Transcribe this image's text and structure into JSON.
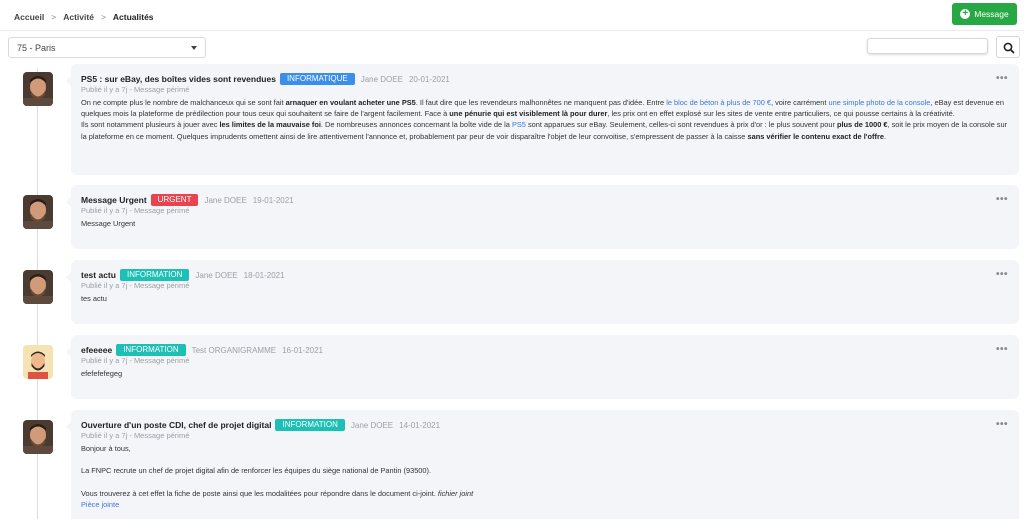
{
  "breadcrumb": {
    "home": "Accueil",
    "section": "Activité",
    "current": "Actualités",
    "separator": ">"
  },
  "toolbar": {
    "message_label": "Message"
  },
  "filter": {
    "location": "75 - Paris"
  },
  "common": {
    "published": "Publié il y a 7j - Message périmé",
    "more": "•••"
  },
  "colors": {
    "informatique": "#3b8fe8",
    "urgent": "#e8434f",
    "information": "#1dc0b5",
    "success": "#28a745"
  },
  "posts": [
    {
      "title": "PS5 : sur eBay, des boîtes vides sont revendues",
      "badge": "INFORMATIQUE",
      "author": "Jane DOEE",
      "date": "20-01-2021",
      "p1": {
        "t1": "On ne compte plus le nombre de malchanceux qui se sont fait ",
        "b1": "arnaquer en voulant acheter une PS5",
        "t2": ". Il faut dire que les revendeurs malhonnêtes ne manquent pas d'idée. Entre ",
        "l1": "le bloc de béton à plus de 700 €",
        "t3": ", voire carrément ",
        "l2": "une simple photo de la console",
        "t4": ", eBay est devenue en quelques mois la plateforme de prédilection pour tous ceux qui souhaitent se faire de l'argent facilement. Face à ",
        "b2": "une pénurie qui est visiblement là pour durer",
        "t5": ", les prix ont en effet explosé sur les sites de vente entre particuliers, ce qui pousse certains à la créativité."
      },
      "p2": {
        "t1": "Ils sont notamment plusieurs à jouer avec ",
        "b1": "les limites de la mauvaise foi",
        "t2": ". De nombreuses annonces concernant la boîte vide de la ",
        "l1": "PS5",
        "t3": " sont apparues sur eBay. Seulement, celles-ci sont revendues à prix d'or : le plus souvent pour ",
        "b2": "plus de 1000 €",
        "t4": ", soit le prix moyen de la console sur la plateforme en ce moment. Quelques imprudents omettent ainsi de lire attentivement l'annonce et, probablement par peur de voir disparaître l'objet de leur convoitise, s'empressent de passer à la caisse ",
        "b3": "sans vérifier le contenu exact de l'offre",
        "t5": "."
      }
    },
    {
      "title": "Message Urgent",
      "badge": "URGENT",
      "author": "Jane DOEE",
      "date": "19-01-2021",
      "body": "Message Urgent"
    },
    {
      "title": "test actu",
      "badge": "INFORMATION",
      "author": "Jane DOEE",
      "date": "18-01-2021",
      "body": "tes actu"
    },
    {
      "title": "efeeeee",
      "badge": "INFORMATION",
      "author": "Test ORGANIGRAMME",
      "date": "16-01-2021",
      "body": "efefefefegeg"
    },
    {
      "title": "Ouverture d'un poste CDI, chef de projet digital",
      "badge": "INFORMATION",
      "author": "Jane DOEE",
      "date": "14-01-2021",
      "line1": "Bonjour à tous,",
      "line2": "La FNPC recrute un chef de projet digital afin de renforcer les équipes du siège national de Pantin (93500).",
      "line3": "Vous trouverez à cet effet la fiche de poste ainsi que les modalitées pour répondre dans le document ci-joint.",
      "line3_italic": "fichier joint",
      "attachment": "Pièce jointe"
    }
  ]
}
